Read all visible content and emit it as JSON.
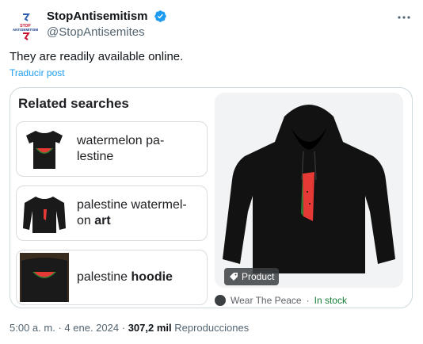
{
  "author": {
    "display_name": "StopAntisemitism",
    "handle": "@StopAntisemites"
  },
  "tweet": {
    "text": "They are readily available online.",
    "translate_label": "Traducir post"
  },
  "embed": {
    "related_title": "Related searches",
    "cards": [
      {
        "line1": "watermelon pa-",
        "line2": "lestine",
        "bold": ""
      },
      {
        "line1": "palestine watermel-",
        "line2": "on ",
        "bold": "art"
      },
      {
        "line1": "palestine ",
        "line2": "",
        "bold": "hoodie"
      }
    ],
    "product_badge": "Product",
    "seller": "Wear The Peace",
    "separator": "·",
    "stock": "In stock"
  },
  "meta": {
    "time": "5:00 a. m.",
    "dot": "·",
    "date": "4 ene. 2024",
    "dot2": "·",
    "views": "307,2 mil",
    "views_label": "Reproducciones"
  },
  "colors": {
    "accent": "#1d9bf0",
    "verified": "#1d9bf0",
    "stock": "#188038"
  },
  "icons": [
    "logo-icon",
    "verified-icon",
    "more-icon",
    "tag-icon",
    "seller-icon"
  ]
}
